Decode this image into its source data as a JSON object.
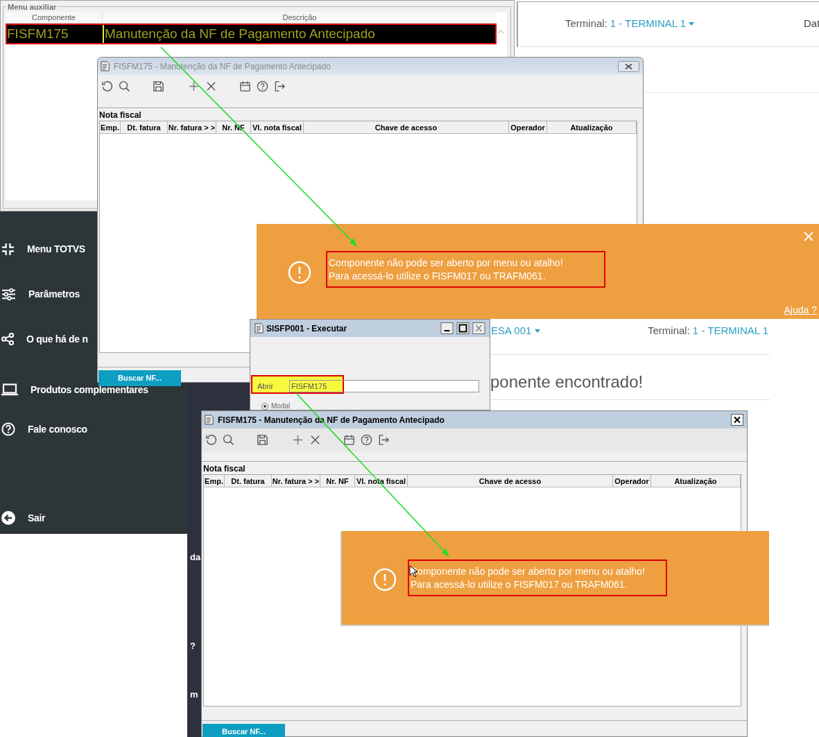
{
  "menu_auxiliar": {
    "legend": "Menu auxiliar",
    "columns": [
      "Componente",
      "Descrição"
    ],
    "rows": [
      {
        "cells": [
          "FISFM175",
          "Manutenção da NF de Pagamento Antecipado"
        ],
        "selected": true
      }
    ]
  },
  "top_header": {
    "terminal_label": "Terminal:",
    "terminal_value": "1 - TERMINAL 1",
    "date_label": "Dat"
  },
  "sidebar": {
    "items": [
      {
        "label": "Menu TOTVS"
      },
      {
        "label": "Parâmetros"
      },
      {
        "label": "O que há de n"
      },
      {
        "label": "Produtos complementares"
      },
      {
        "label": "Fale conosco"
      },
      {
        "label": "Sair"
      }
    ]
  },
  "background_fragments": [
    "da",
    "?",
    "m"
  ],
  "windows": [
    {
      "title": "FISFM175 - Manutenção da NF de Pagamento Antecipado",
      "active": false,
      "section": "Nota fiscal",
      "columns": [
        "Emp.",
        "Dt. fatura",
        "Nr. fatura > >",
        "Nr. NF",
        "Vl. nota fiscal",
        "Chave de acesso",
        "Operador",
        "Atualização"
      ],
      "button": "Buscar NF..."
    },
    {
      "title": "FISFM175 - Manutenção da NF de Pagamento Antecipado",
      "active": true,
      "section": "Nota fiscal",
      "columns": [
        "Emp.",
        "Dt. fatura",
        "Nr. fatura > >",
        "Nr. NF",
        "Vl. nota fiscal",
        "Chave de acesso",
        "Operador",
        "Atualização"
      ],
      "button": "Buscar NF..."
    }
  ],
  "alerts": [
    {
      "lines": [
        "Componente não pode ser aberto por menu ou atalho!",
        "Para acessá-lo utilize o FISFM017 ou TRAFM061."
      ],
      "help_link": "Ajuda ?",
      "closable": true
    },
    {
      "lines": [
        "Componente não pode ser aberto por menu ou atalho!",
        "Para acessá-lo utilize o FISFM017 ou TRAFM061."
      ],
      "closable": false
    }
  ],
  "web_page_2": {
    "company": "ESA 001",
    "terminal_label": "Terminal:",
    "terminal_value": "1 - TERMINAL 1",
    "heading": "ponente encontrado!"
  },
  "run_dialog": {
    "title": "SISFP001 - Executar",
    "field_label": "Abrir",
    "value": "FISFM175",
    "option": "Modal",
    "option_selected": true
  }
}
